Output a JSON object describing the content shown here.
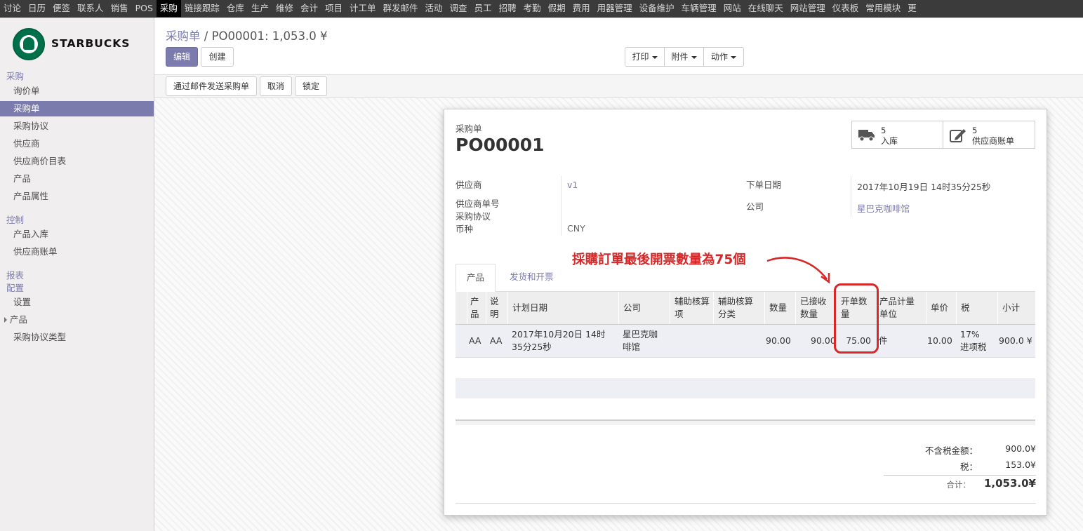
{
  "topmenu": [
    "讨论",
    "日历",
    "便签",
    "联系人",
    "销售",
    "POS",
    "采购",
    "链接跟踪",
    "仓库",
    "生产",
    "维修",
    "会计",
    "项目",
    "计工单",
    "群发邮件",
    "活动",
    "调查",
    "员工",
    "招聘",
    "考勤",
    "假期",
    "费用",
    "用器管理",
    "设备维护",
    "车辆管理",
    "网站",
    "在线聊天",
    "网站管理",
    "仪表板",
    "常用模块",
    "更"
  ],
  "logo": {
    "text": "STARBUCKS",
    "brand_color": "#00704a"
  },
  "sidebar": {
    "purchase": {
      "title": "采购",
      "items": [
        "询价单",
        "采购单",
        "采购协议",
        "供应商",
        "供应商价目表",
        "产品",
        "产品属性"
      ]
    },
    "control": {
      "title": "控制",
      "items": [
        "产品入库",
        "供应商账单"
      ]
    },
    "report": {
      "title": "报表"
    },
    "config": {
      "title": "配置",
      "items": [
        "设置",
        "产品",
        "采购协议类型"
      ]
    }
  },
  "breadcrumb": {
    "parent": "采购单",
    "sep": "/",
    "current": "PO00001: 1,053.0 ¥"
  },
  "buttons": {
    "edit": "编辑",
    "create": "创建",
    "print": "打印",
    "attachment": "附件",
    "action": "动作"
  },
  "status_buttons": {
    "send_email": "通过邮件发送采购单",
    "cancel": "取消",
    "lock": "锁定"
  },
  "form": {
    "doc_type": "采购单",
    "name": "PO00001",
    "smart_buttons": [
      {
        "count": "5",
        "label": "入库",
        "icon": "truck-icon"
      },
      {
        "count": "5",
        "label": "供应商账单",
        "icon": "edit-icon"
      }
    ],
    "fields": {
      "vendor_label": "供应商",
      "vendor": "v1",
      "vendor_ref_label": "供应商单号",
      "agreement_label": "采购协议",
      "currency_label": "币种",
      "currency": "CNY",
      "order_date_label": "下单日期",
      "order_date": "2017年10月19日 14时35分25秒",
      "company_label": "公司",
      "company": "星巴克咖啡馆"
    },
    "tabs": [
      "产品",
      "发货和开票"
    ],
    "columns": [
      "产品",
      "说明",
      "计划日期",
      "公司",
      "辅助核算项",
      "辅助核算分类",
      "数量",
      "已接收数量",
      "开单数量",
      "产品计量单位",
      "单价",
      "税",
      "小计"
    ],
    "lines": [
      {
        "product": "AA",
        "description": "AA",
        "date_planned": "2017年10月20日 14时35分25秒",
        "company": "星巴克咖啡馆",
        "analytic_account": "",
        "analytic_tags": "",
        "qty": "90.00",
        "qty_received": "90.00",
        "qty_invoiced": "75.00",
        "uom": "件",
        "price_unit": "10.00",
        "taxes": "17%进项税",
        "subtotal": "900.0 ¥"
      }
    ],
    "totals": {
      "untaxed_label": "不含税金额：",
      "untaxed": "900.0¥",
      "tax_label": "税：",
      "tax": "153.0¥",
      "total_label": "合计：",
      "total": "1,053.0¥"
    }
  },
  "annotation": {
    "text": "採購訂單最後開票數量為75個",
    "color": "#d62828"
  }
}
